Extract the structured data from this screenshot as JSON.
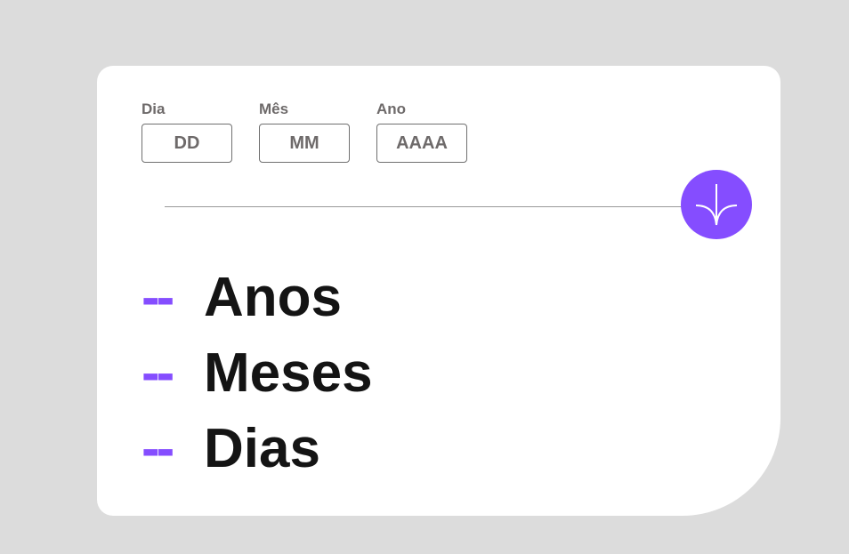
{
  "form": {
    "day": {
      "label": "Dia",
      "placeholder": "DD",
      "value": ""
    },
    "month": {
      "label": "Mês",
      "placeholder": "MM",
      "value": ""
    },
    "year": {
      "label": "Ano",
      "placeholder": "AAAA",
      "value": ""
    }
  },
  "submit": {
    "icon": "arrow-down-icon",
    "color": "#854dff"
  },
  "results": [
    {
      "value": "--",
      "label": "Anos"
    },
    {
      "value": "--",
      "label": "Meses"
    },
    {
      "value": "--",
      "label": "Dias"
    }
  ],
  "colors": {
    "accent": "#854dff",
    "text": "#141414",
    "muted": "#6e6a6a",
    "background": "#dcdcdc",
    "card": "#ffffff"
  }
}
